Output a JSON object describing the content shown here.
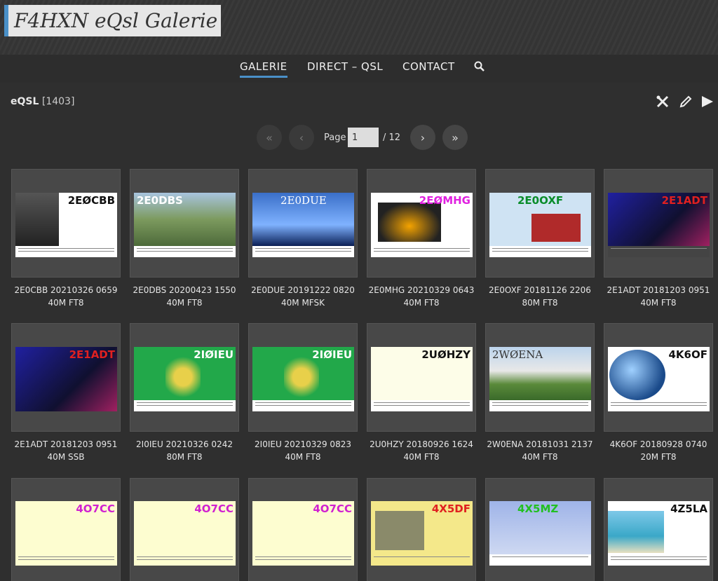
{
  "site": {
    "title": "F4HXN eQsl Galerie"
  },
  "nav": {
    "items": [
      {
        "label": "GALERIE"
      },
      {
        "label": "DIRECT – QSL"
      },
      {
        "label": "CONTACT"
      }
    ]
  },
  "album": {
    "title": "eQSL",
    "count": "[1403]"
  },
  "pagination": {
    "label": "Page",
    "current": "1",
    "total": "/ 12"
  },
  "thumbnails": [
    {
      "call": "2EØCBB",
      "line1": "2E0CBB 20210326 0659",
      "line2": "40M FT8"
    },
    {
      "call": "2E0DBS",
      "line1": "2E0DBS 20200423 1550",
      "line2": "40M FT8"
    },
    {
      "call": "2E0DUE",
      "line1": "2E0DUE 20191222 0820",
      "line2": "40M MFSK"
    },
    {
      "call": "2EØMHG",
      "line1": "2E0MHG 20210329 0643",
      "line2": "40M FT8"
    },
    {
      "call": "2E0OXF",
      "line1": "2E0OXF 20181126 2206",
      "line2": "80M FT8"
    },
    {
      "call": "2E1ADT",
      "line1": "2E1ADT 20181203 0951",
      "line2": "40M FT8"
    },
    {
      "call": "2E1ADT",
      "line1": "2E1ADT 20181203 0951",
      "line2": "40M SSB"
    },
    {
      "call": "2IØIEU",
      "line1": "2I0IEU 20210326 0242",
      "line2": "80M FT8"
    },
    {
      "call": "2IØIEU",
      "line1": "2I0IEU 20210329 0823",
      "line2": "40M FT8"
    },
    {
      "call": "2UØHZY",
      "line1": "2U0HZY 20180926 1624",
      "line2": "40M FT8"
    },
    {
      "call": "2WØENA",
      "line1": "2W0ENA 20181031 2137",
      "line2": "40M FT8"
    },
    {
      "call": "4K6OF",
      "line1": "4K6OF 20180928 0740",
      "line2": "20M FT8"
    },
    {
      "call": "4O7CC",
      "line1": "",
      "line2": ""
    },
    {
      "call": "4O7CC",
      "line1": "",
      "line2": ""
    },
    {
      "call": "4O7CC",
      "line1": "",
      "line2": ""
    },
    {
      "call": "4X5DF",
      "line1": "",
      "line2": ""
    },
    {
      "call": "4X5MZ",
      "line1": "",
      "line2": ""
    },
    {
      "call": "4Z5LA",
      "line1": "",
      "line2": ""
    }
  ],
  "colors": {
    "accent": "#4a90c8",
    "background": "#2f2f2f",
    "tile": "#484848"
  },
  "icons": [
    "search-icon",
    "tools-icon",
    "pencil-icon",
    "play-icon"
  ]
}
